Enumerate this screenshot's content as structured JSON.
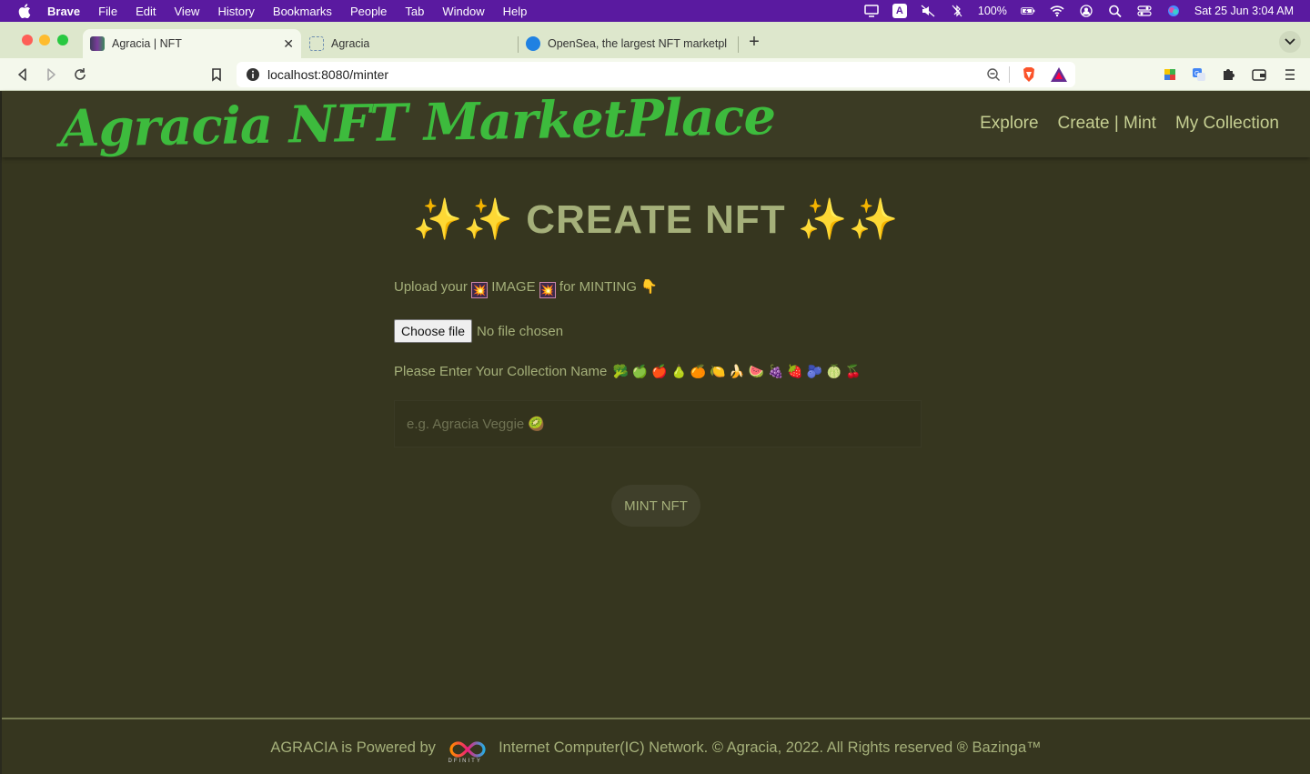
{
  "menubar": {
    "app": "Brave",
    "items": [
      "File",
      "Edit",
      "View",
      "History",
      "Bookmarks",
      "People",
      "Tab",
      "Window",
      "Help"
    ],
    "input_source": "A",
    "battery": "100%",
    "datetime": "Sat 25 Jun  3:04 AM"
  },
  "tabs": [
    {
      "label": "Agracia | NFT",
      "active": true
    },
    {
      "label": "Agracia",
      "active": false
    },
    {
      "label": "OpenSea, the largest NFT marketpl",
      "active": false
    }
  ],
  "toolbar": {
    "url": "localhost:8080/minter"
  },
  "site": {
    "logo": "Agracia NFT MarketPlace",
    "nav": [
      "Explore",
      "Create | Mint",
      "My Collection"
    ]
  },
  "form": {
    "title": "CREATE NFT",
    "sparkles": "✨✨",
    "upload_prefix": "Upload your",
    "upload_image": "IMAGE",
    "upload_suffix": "for MINTING",
    "upload_emoji_left": "💥",
    "upload_emoji_right": "💥",
    "upload_pointer": "👇",
    "choose_file": "Choose file",
    "no_file": "No file chosen",
    "collection_label": "Please Enter Your Collection Name",
    "fruits": "🥦 🍏 🍎 🍐 🍊 🍋 🍌 🍉 🍇 🍓 🫐 🍈 🍒",
    "input_placeholder": "e.g. Agracia Veggie 🥝",
    "mint_button": "MINT NFT"
  },
  "footer": {
    "prefix": "AGRACIA is Powered by",
    "logo_text": "DFINITY",
    "suffix": "Internet Computer(IC) Network. © Agracia, 2022. All Rights reserved ® Bazinga™"
  },
  "colors": {
    "menubar": "#5a1aa0",
    "page_bg": "#36361f",
    "logo_green": "#3dbb3d",
    "text_khaki": "#a5b07a",
    "nav_text": "#c6cf92"
  }
}
